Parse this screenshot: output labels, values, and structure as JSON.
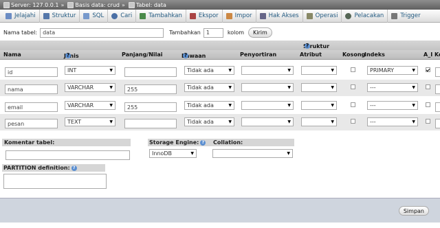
{
  "breadcrumb": {
    "server": "Server: 127.0.0.1",
    "database": "Basis data: crud",
    "table": "Tabel: data",
    "separator": "»"
  },
  "tabs": [
    {
      "label": "Jelajahi",
      "icon": "browse-icon",
      "color": "#6b8cc4"
    },
    {
      "label": "Struktur",
      "icon": "structure-icon",
      "color": "#5577aa"
    },
    {
      "label": "SQL",
      "icon": "sql-icon",
      "color": "#7799cc"
    },
    {
      "label": "Cari",
      "icon": "search-icon",
      "color": "#4a6fa5"
    },
    {
      "label": "Tambahkan",
      "icon": "insert-icon",
      "color": "#4a8a4a"
    },
    {
      "label": "Ekspor",
      "icon": "export-icon",
      "color": "#aa4444"
    },
    {
      "label": "Impor",
      "icon": "import-icon",
      "color": "#cc8844"
    },
    {
      "label": "Hak Akses",
      "icon": "privileges-icon",
      "color": "#666688"
    },
    {
      "label": "Operasi",
      "icon": "operations-icon",
      "color": "#888866"
    },
    {
      "label": "Pelacakan",
      "icon": "tracking-icon",
      "color": "#556655"
    },
    {
      "label": "Trigger",
      "icon": "trigger-icon",
      "color": "#777777"
    }
  ],
  "form": {
    "table_name_label": "Nama tabel:",
    "table_name_value": "data",
    "add_label": "Tambahkan",
    "add_count": "1",
    "column_label": "kolom",
    "submit_label": "Kirim"
  },
  "headers": {
    "group": "Struktur",
    "name": "Nama",
    "type": "Jenis",
    "length": "Panjang/Nilai",
    "default": "Bawaan",
    "collation": "Penyortiran",
    "attribute": "Atribut",
    "null": "Kosong",
    "index": "Indeks",
    "ai": "A_I",
    "comment": "Ko"
  },
  "columns": [
    {
      "name": "id",
      "type": "INT",
      "length": "",
      "default": "Tidak ada",
      "index": "PRIMARY",
      "ai": true
    },
    {
      "name": "nama",
      "type": "VARCHAR",
      "length": "255",
      "default": "Tidak ada",
      "index": "---",
      "ai": false
    },
    {
      "name": "email",
      "type": "VARCHAR",
      "length": "255",
      "default": "Tidak ada",
      "index": "---",
      "ai": false
    },
    {
      "name": "pesan",
      "type": "TEXT",
      "length": "",
      "default": "Tidak ada",
      "index": "---",
      "ai": false
    }
  ],
  "table_options": {
    "comment_label": "Komentar tabel:",
    "engine_label": "Storage Engine:",
    "engine_value": "InnoDB",
    "collation_label": "Collation:",
    "partition_label": "PARTITION definition:"
  },
  "save_label": "Simpan"
}
